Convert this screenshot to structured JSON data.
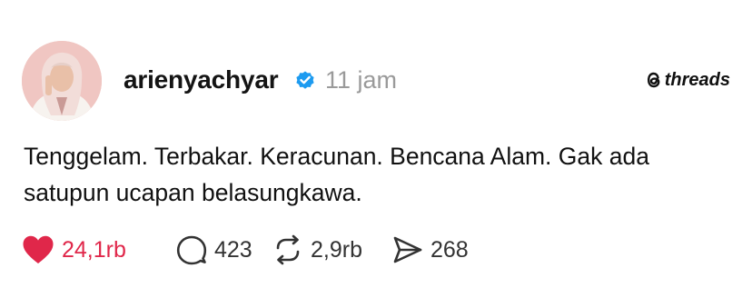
{
  "post": {
    "username": "arienyachyar",
    "time": "11 jam",
    "text": "Tenggelam. Terbakar. Keracunan. Bencana Alam. Gak ada satupun ucapan belasungkawa."
  },
  "brand": {
    "name": "threads"
  },
  "actions": {
    "likes": "24,1rb",
    "comments": "423",
    "reposts": "2,9rb",
    "shares": "268"
  },
  "colors": {
    "like": "#e0274a",
    "verified": "#1d9bf0",
    "muted": "#9a9a9a"
  },
  "icons": [
    "heart-icon",
    "comment-icon",
    "repost-icon",
    "share-icon",
    "verified-badge-icon",
    "threads-logo-icon"
  ]
}
